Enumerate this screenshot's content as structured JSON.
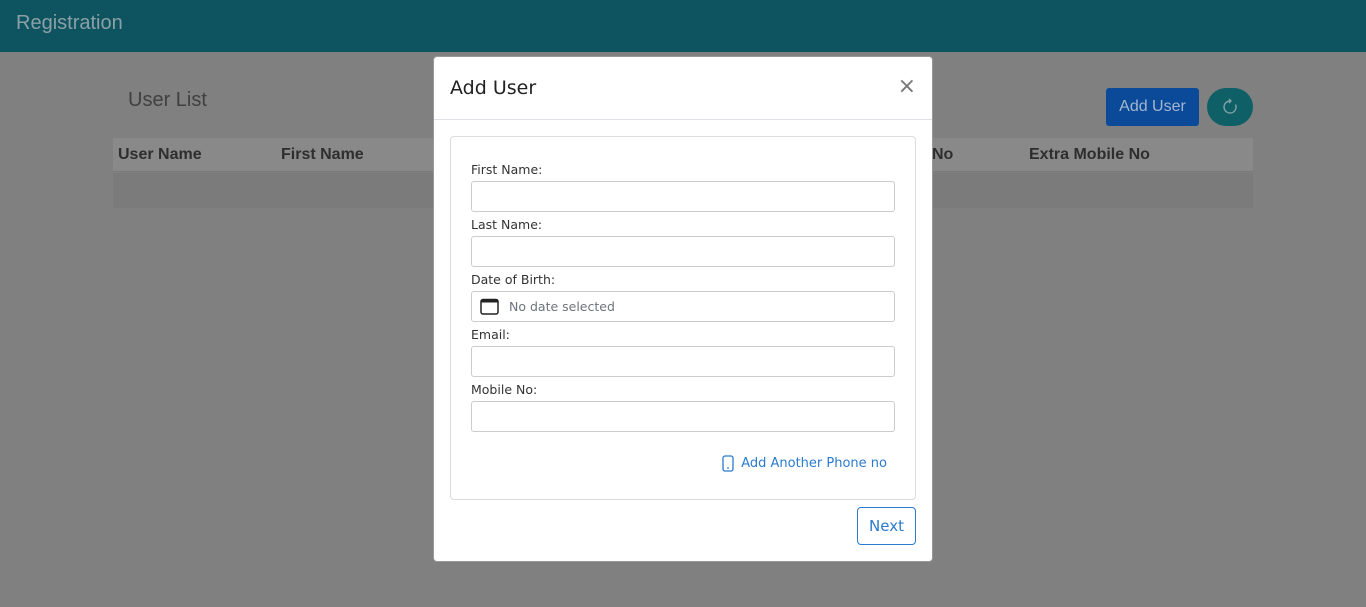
{
  "navbar": {
    "brand": "Registration"
  },
  "page": {
    "title": "User List",
    "add_user_label": "Add User",
    "refresh_icon": "refresh-icon"
  },
  "table": {
    "headers": [
      "User Name",
      "First Name",
      "No",
      "Extra Mobile No"
    ]
  },
  "modal": {
    "title": "Add User",
    "close_label": "×",
    "fields": {
      "first_name": {
        "label": "First Name:",
        "value": ""
      },
      "last_name": {
        "label": "Last Name:",
        "value": ""
      },
      "dob": {
        "label": "Date of Birth:",
        "placeholder": "No date selected"
      },
      "email": {
        "label": "Email:",
        "value": ""
      },
      "mobile": {
        "label": "Mobile No:",
        "value": ""
      }
    },
    "add_phone_label": "Add Another Phone no",
    "next_label": "Next"
  },
  "colors": {
    "navbar": "#0e5360",
    "primary": "#0a4a99",
    "link": "#2a7bd0"
  }
}
